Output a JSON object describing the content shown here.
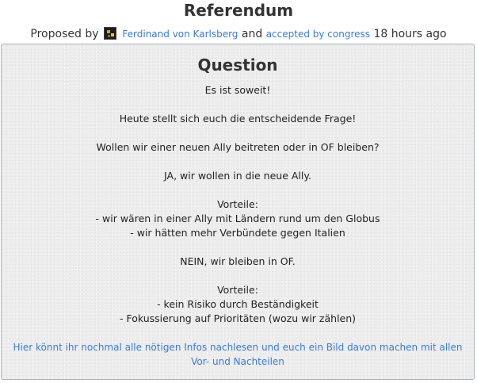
{
  "header": {
    "title": "Referendum",
    "proposed_by_label": "Proposed by",
    "author_name": "Ferdinand von Karlsberg",
    "and_label": "and",
    "status_link": "accepted by congress",
    "time_ago": "18 hours ago"
  },
  "question": {
    "heading": "Question",
    "lines": [
      "Es ist soweit!",
      "",
      "Heute stellt sich euch die entscheidende Frage!",
      "",
      "Wollen wir einer neuen Ally beitreten oder in OF bleiben?",
      "",
      "JA, wir wollen in die neue Ally.",
      "",
      "Vorteile:",
      "- wir wären in einer Ally mit Ländern rund um den Globus",
      "- wir hätten mehr Verbündete gegen Italien",
      "",
      "NEIN, wir bleiben in OF.",
      "",
      "Vorteile:",
      "- kein Risiko durch Beständigkeit",
      "- Fokussierung auf Prioritäten (wozu wir zählen)"
    ],
    "info_link": "Hier könnt ihr nochmal alle nötigen Infos nachlesen und euch ein Bild davon machen mit allen Vor- und Nachteilen"
  },
  "colors": {
    "link": "#3a7bd5",
    "panel_background": "#ededed",
    "panel_border": "#a9b4bd"
  },
  "icons": {
    "author_avatar": "avatar-icon"
  }
}
